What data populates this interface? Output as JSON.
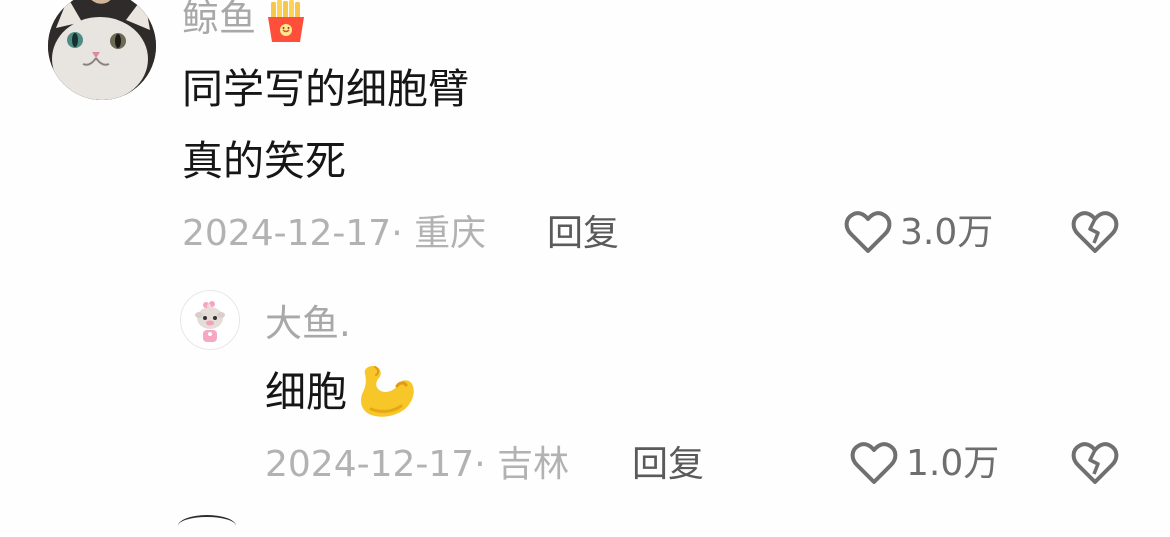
{
  "comments": [
    {
      "username": "鲸鱼",
      "text_lines": [
        "同学写的细胞臂",
        "真的笑死"
      ],
      "date": "2024-12-17",
      "location": "重庆",
      "reply_label": "回复",
      "likes": "3.0万",
      "badge_icon": "fries-icon"
    },
    {
      "username": "大鱼.",
      "text": "细胞",
      "text_emoji": "flexed-biceps-icon",
      "date": "2024-12-17",
      "location": "吉林",
      "reply_label": "回复",
      "likes": "1.0万"
    }
  ],
  "colors": {
    "username": "#a8a8a8",
    "body_text": "#161616",
    "meta": "#b2b2b2",
    "reply": "#5a5a5a",
    "icon": "#707070"
  }
}
